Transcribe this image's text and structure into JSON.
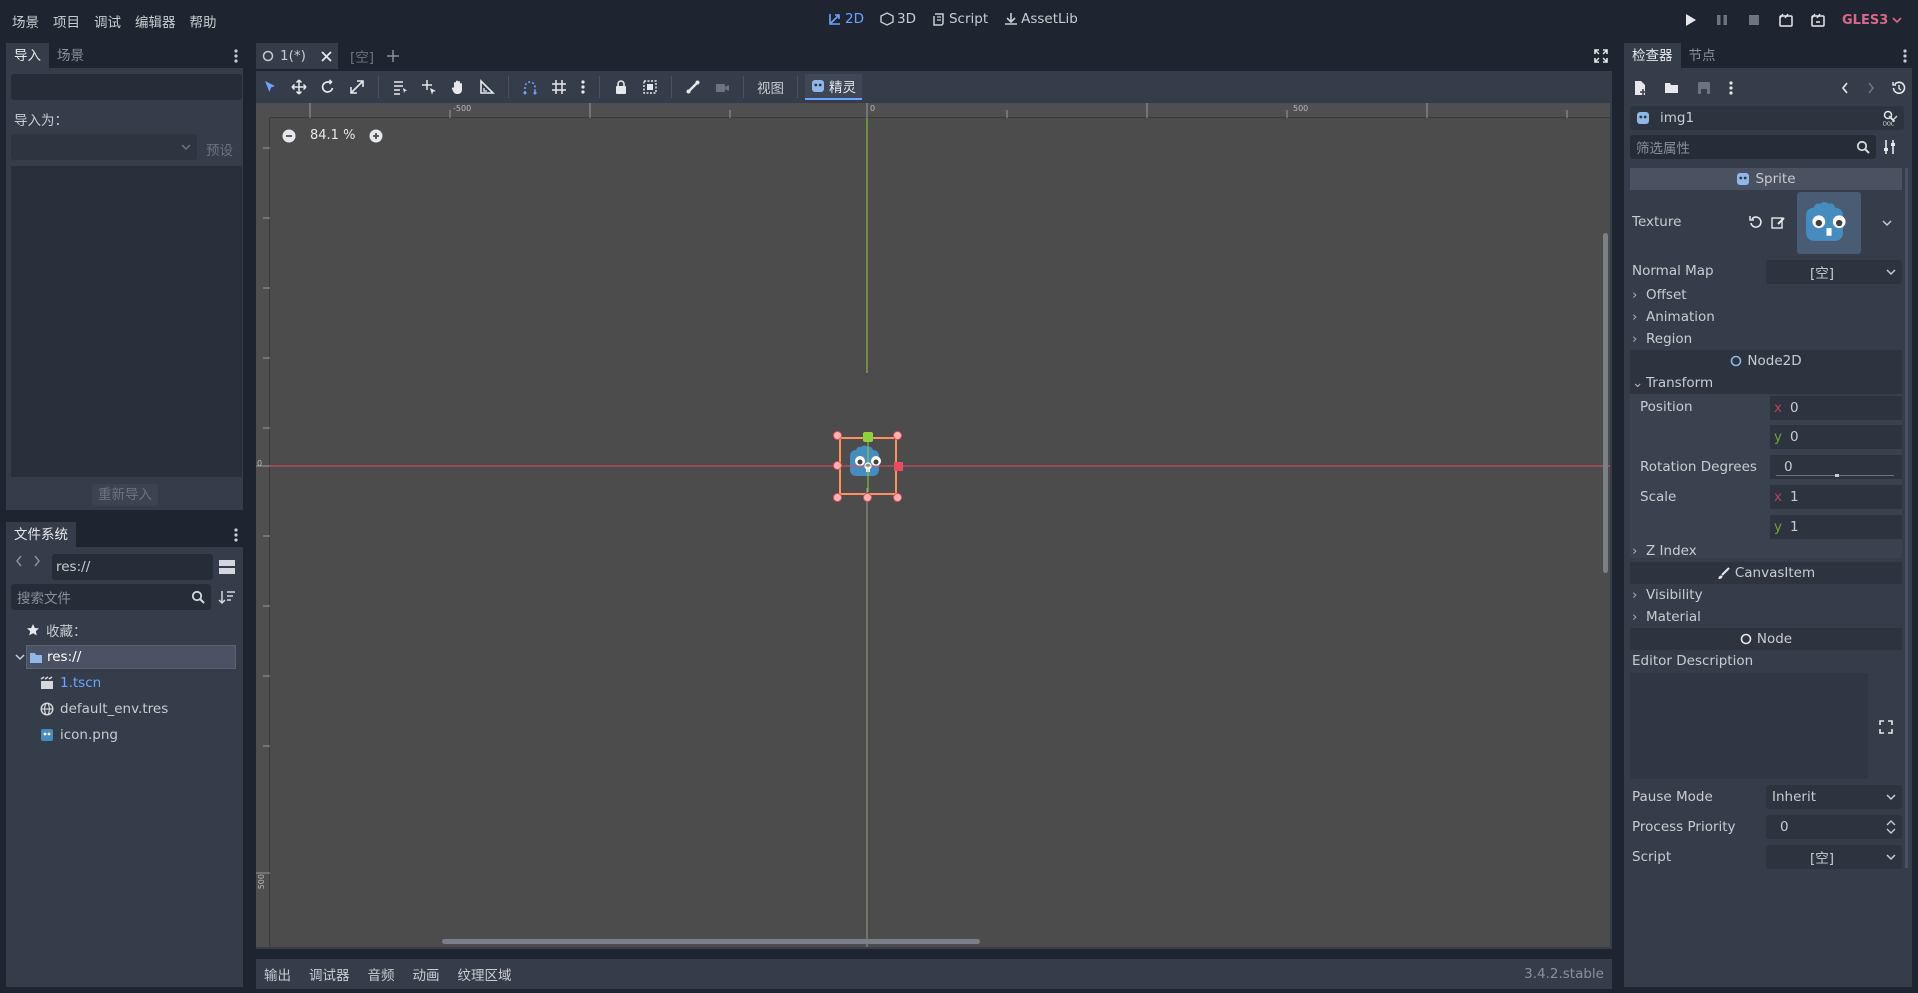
{
  "menu": [
    "场景",
    "项目",
    "调试",
    "编辑器",
    "帮助"
  ],
  "workspaces": [
    {
      "label": "2D",
      "active": true
    },
    {
      "label": "3D",
      "active": false
    },
    {
      "label": "Script",
      "active": false
    },
    {
      "label": "AssetLib",
      "active": false
    }
  ],
  "renderer": "GLES3",
  "left_top": {
    "tabs": [
      "导入",
      "场景"
    ],
    "import_as_label": "导入为：",
    "preset_label": "预设",
    "reimport_label": "重新导入"
  },
  "filesystem": {
    "title": "文件系统",
    "path": "res://",
    "search_placeholder": "搜索文件",
    "favorites_label": "收藏：",
    "root_label": "res://",
    "files": [
      {
        "name": "1.tscn",
        "icon": "scene-icon",
        "highlight": true
      },
      {
        "name": "default_env.tres",
        "icon": "globe-icon",
        "highlight": false
      },
      {
        "name": "icon.png",
        "icon": "image-icon",
        "highlight": false
      }
    ]
  },
  "scene_tabs": [
    {
      "label": "1(*)",
      "active": true
    },
    {
      "label": "[空]",
      "active": false
    }
  ],
  "toolbar": {
    "view_label": "视图",
    "sprite_label": "精灵"
  },
  "viewport": {
    "zoom": "84.1 %",
    "ruler_top": [
      "-500",
      "0",
      "500"
    ],
    "ruler_left": [
      "0",
      "500"
    ]
  },
  "bottom": {
    "tabs": [
      "输出",
      "调试器",
      "音频",
      "动画",
      "纹理区域"
    ],
    "version": "3.4.2.stable"
  },
  "inspector": {
    "tabs": [
      "检查器",
      "节点"
    ],
    "object_name": "img1",
    "filter_placeholder": "筛选属性",
    "sprite_section": "Sprite",
    "texture_label": "Texture",
    "normal_map_label": "Normal Map",
    "normal_map_value": "[空]",
    "sprite_groups": [
      "Offset",
      "Animation",
      "Region"
    ],
    "node2d_section": "Node2D",
    "transform_label": "Transform",
    "position_label": "Position",
    "position_x": "0",
    "position_y": "0",
    "rotation_label": "Rotation Degrees",
    "rotation_value": "0",
    "scale_label": "Scale",
    "scale_x": "1",
    "scale_y": "1",
    "z_index_label": "Z Index",
    "canvasitem_section": "CanvasItem",
    "canvas_groups": [
      "Visibility",
      "Material"
    ],
    "node_section": "Node",
    "editor_desc_label": "Editor Description",
    "pause_mode_label": "Pause Mode",
    "pause_mode_value": "Inherit",
    "process_priority_label": "Process Priority",
    "process_priority_value": "0",
    "script_label": "Script",
    "script_value": "[空]",
    "x_axis": "x",
    "y_axis": "y"
  },
  "colors": {
    "accent": "#6ba3ff",
    "renderer": "#d9688a",
    "x_axis": "#e84b62",
    "y_axis": "#8fd13a",
    "selection": "#ff8f5f"
  }
}
